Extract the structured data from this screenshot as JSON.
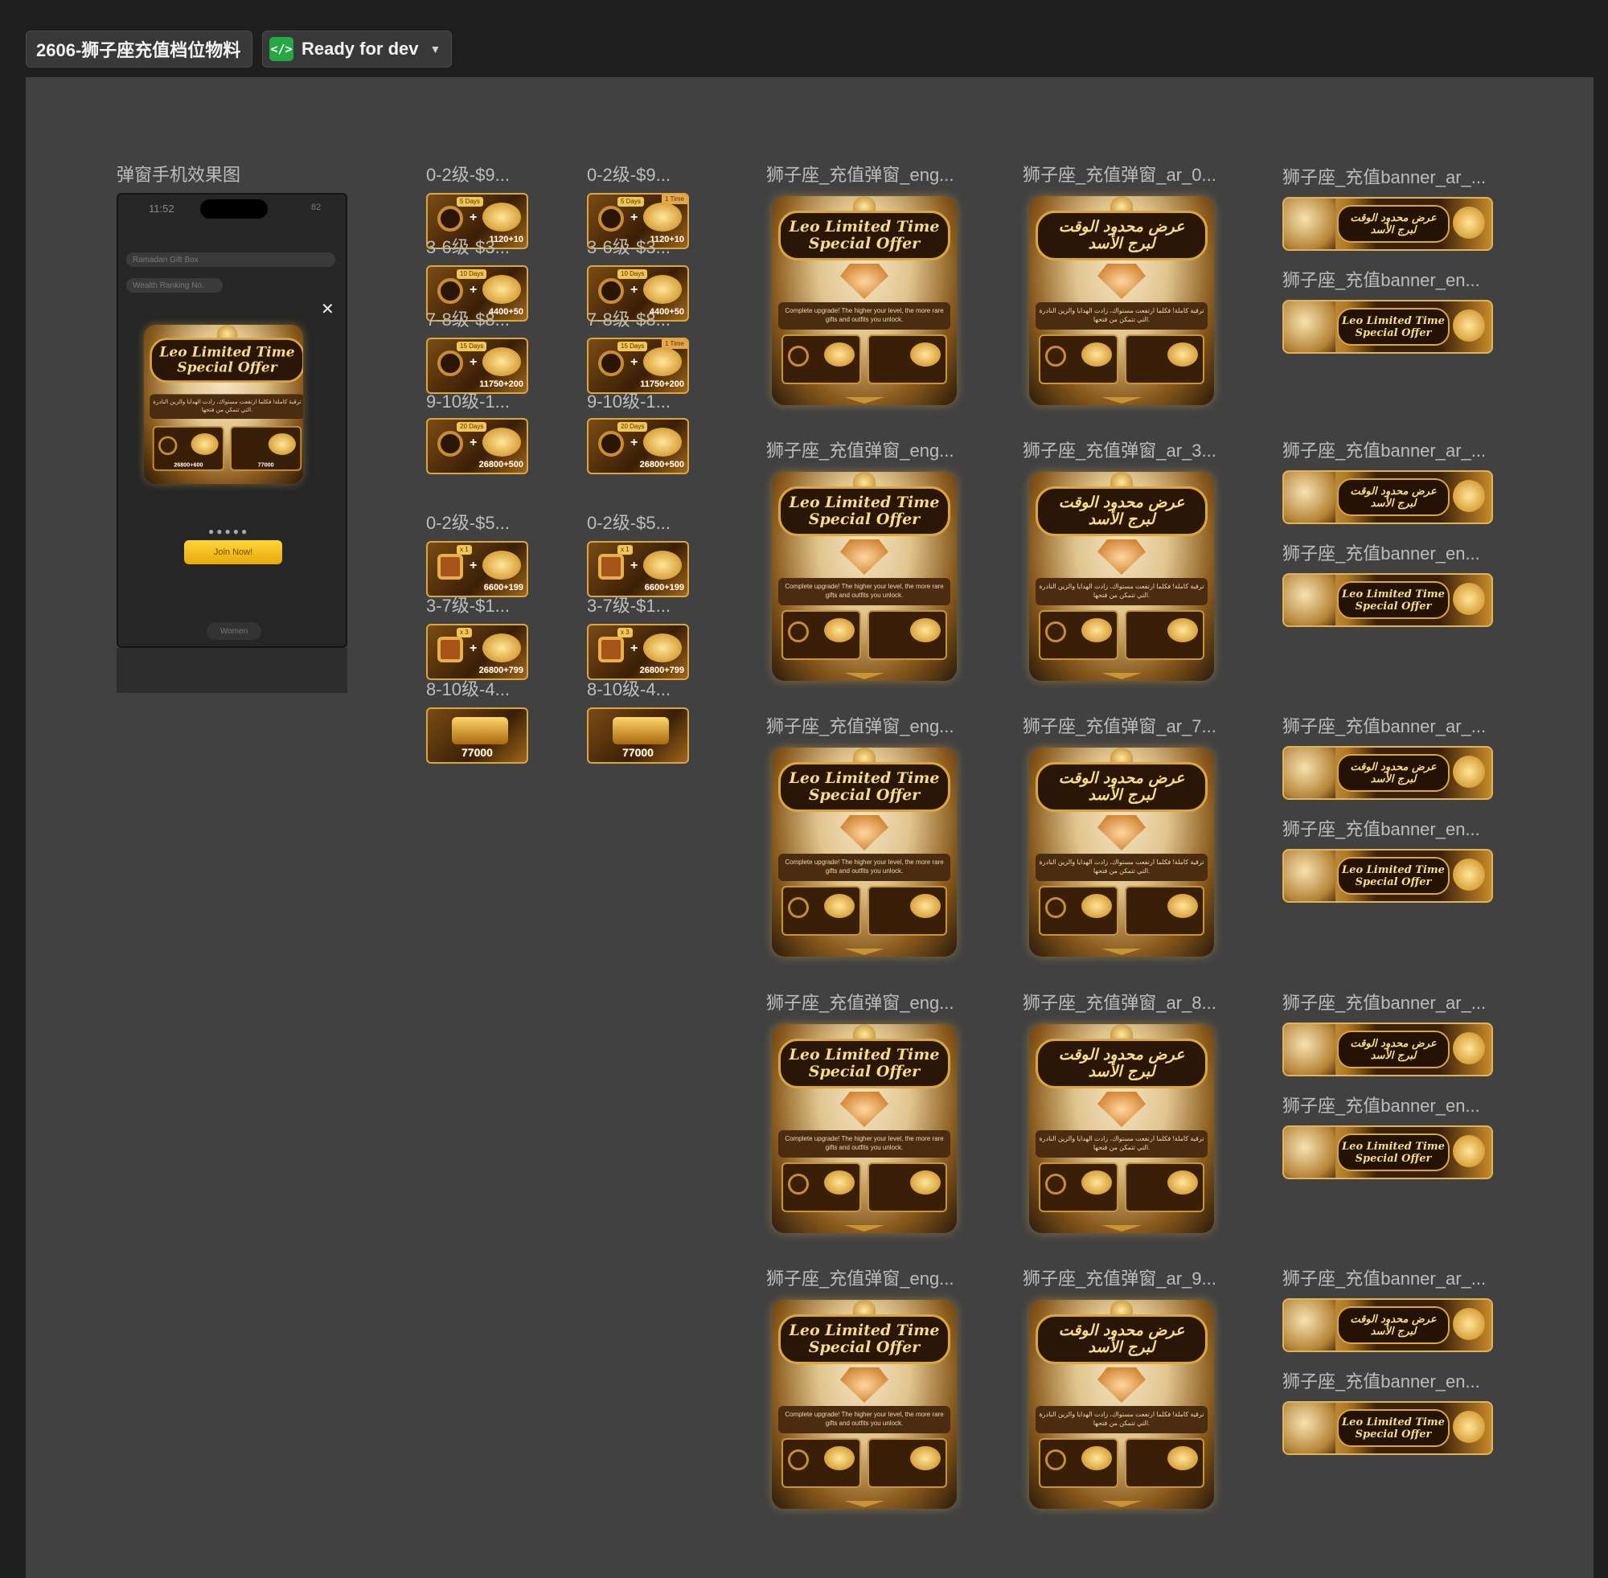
{
  "header": {
    "file_title": "2606-狮子座充值档位物料",
    "status_label": "Ready for dev",
    "status_icon": "code-icon"
  },
  "phone": {
    "label": "弹窗手机效果图",
    "time": "11:52",
    "battery": "82",
    "row1": "Ramadan Gift Box",
    "row2": "Wealth Ranking No.",
    "popup_title_1": "Leo Limited Time",
    "popup_title_2": "Special Offer",
    "popup_desc": "ترقية كاملة! فكلما ارتفعت مستواك، زادت الهدايا والزين النادرة التي تتمكن من فتحها.",
    "pack_a_value": "26800+600",
    "pack_b_value": "77000",
    "join_label": "Join Now!",
    "women_label": "Women"
  },
  "tiers": {
    "col1": {
      "g1_label": "0-2级-$9...",
      "g2_label": "0-2级-$5..."
    },
    "col2": {
      "g1_label": "0-2级-$9...",
      "g2_label": "0-2级-$5..."
    },
    "sub": {
      "l36": "3-6级-$3...",
      "l78": "7-8级-$8...",
      "l910": "9-10级-1...",
      "l37": "3-7级-$1...",
      "l810": "8-10级-4..."
    },
    "values": {
      "v1120": "1120+10",
      "v4400": "4400+50",
      "v11750": "11750+200",
      "v26800": "26800+500",
      "v6600": "6600+199",
      "v26800b": "26800+799",
      "v77000": "77000"
    },
    "tags": {
      "d5": "5 Days",
      "d10": "10 Days",
      "d15": "15 Days",
      "d20": "20 Days",
      "once": "1 Time",
      "x1": "x 1",
      "x3": "x 3"
    }
  },
  "popups": {
    "eng_label": "狮子座_充值弹窗_eng...",
    "ar0_label": "狮子座_充值弹窗_ar_0...",
    "ar3_label": "狮子座_充值弹窗_ar_3...",
    "ar7_label": "狮子座_充值弹窗_ar_7...",
    "ar8_label": "狮子座_充值弹窗_ar_8...",
    "ar9_label": "狮子座_充值弹窗_ar_9...",
    "en_title_1": "Leo Limited Time",
    "en_title_2": "Special Offer",
    "ar_title_1": "عرض محدود الوقت",
    "ar_title_2": "لبرج الأسد",
    "en_desc": "Complete upgrade! The higher your level, the more rare gifts and outfits you unlock.",
    "ar_desc": "ترقية كاملة! فكلما ارتفعت مستواك، زادت الهدايا والزين النادرة التي تتمكن من فتحها."
  },
  "banners": {
    "ar_label": "狮子座_充值banner_ar_...",
    "en_label": "狮子座_充值banner_en...",
    "en_title_1": "Leo Limited Time",
    "en_title_2": "Special Offer",
    "ar_title_1": "عرض محدود الوقت",
    "ar_title_2": "لبرج الأسد"
  }
}
